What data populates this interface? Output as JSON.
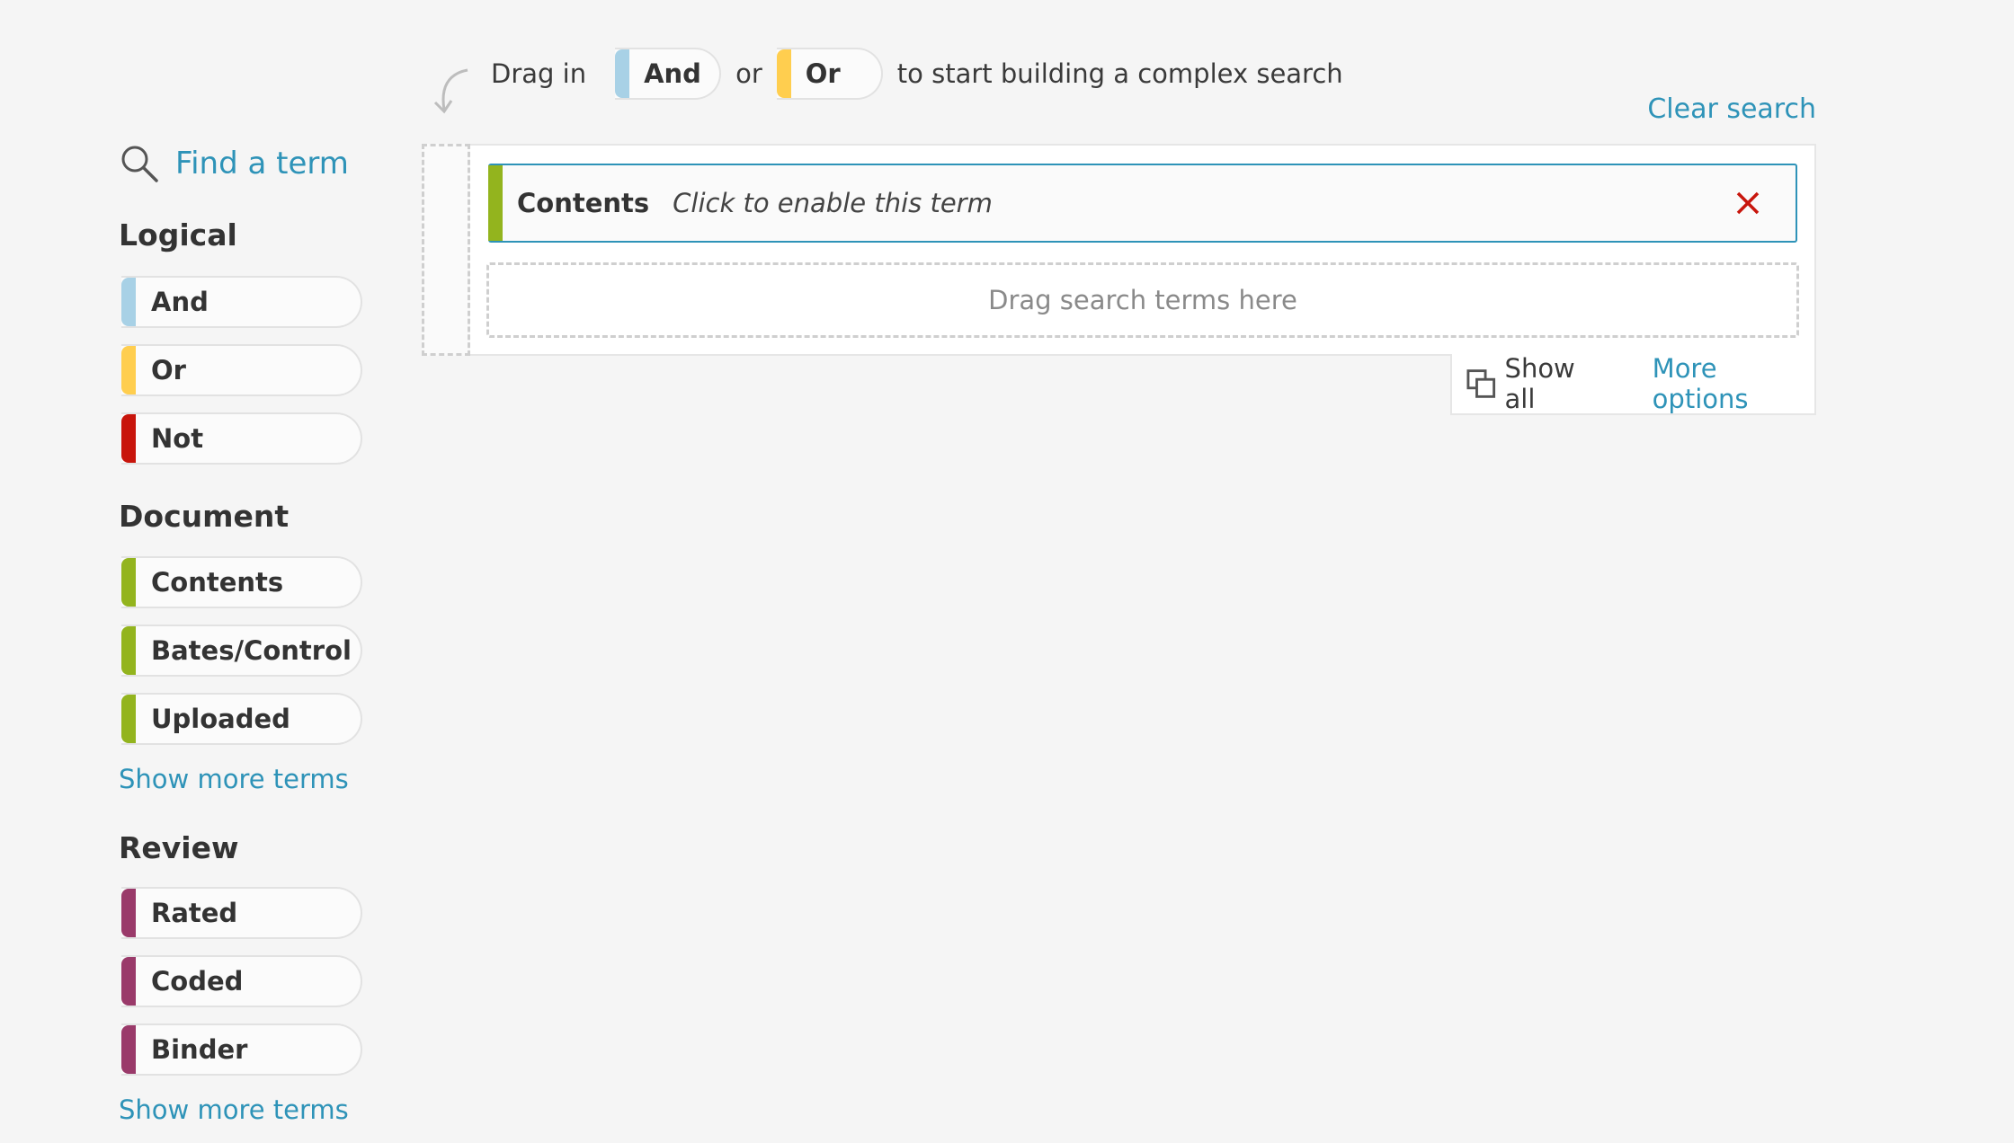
{
  "hint": {
    "prefix": "Drag in",
    "and_label": "And",
    "or_word": "or",
    "or_label": "Or",
    "suffix": "to start building a complex search"
  },
  "clear_search": "Clear search",
  "sidebar": {
    "find_term": "Find a term",
    "sections": [
      {
        "title": "Logical",
        "items": [
          {
            "label": "And",
            "color": "#a8d1e6"
          },
          {
            "label": "Or",
            "color": "#ffce4f"
          },
          {
            "label": "Not",
            "color": "#c8150c"
          }
        ]
      },
      {
        "title": "Document",
        "items": [
          {
            "label": "Contents",
            "color": "#93b41e"
          },
          {
            "label": "Bates/Control",
            "color": "#93b41e"
          },
          {
            "label": "Uploaded",
            "color": "#93b41e"
          }
        ],
        "show_more": "Show more terms"
      },
      {
        "title": "Review",
        "items": [
          {
            "label": "Rated",
            "color": "#9a3a6a"
          },
          {
            "label": "Coded",
            "color": "#9a3a6a"
          },
          {
            "label": "Binder",
            "color": "#9a3a6a"
          }
        ],
        "show_more": "Show more terms"
      }
    ]
  },
  "builder": {
    "term_name": "Contents",
    "term_desc": "Click to enable this term",
    "drop_zone": "Drag search terms here",
    "show_all": "Show all",
    "more_options": "More options"
  },
  "colors": {
    "link": "#2e93b8",
    "close": "#c8150c"
  }
}
